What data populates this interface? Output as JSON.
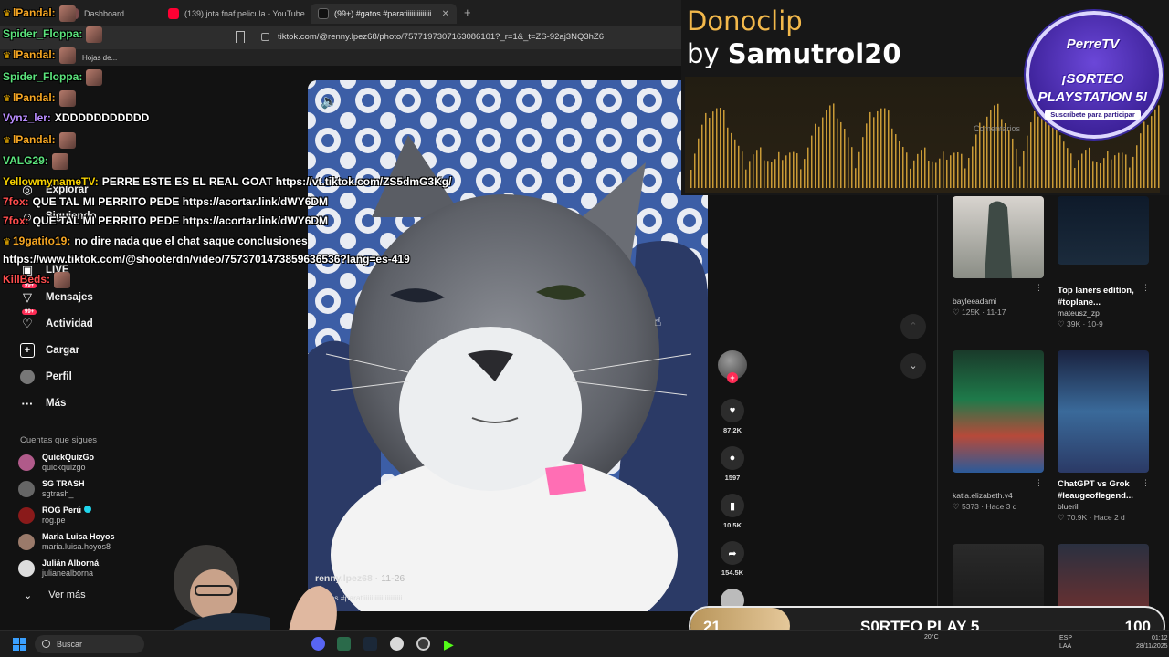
{
  "browser": {
    "tabs": [
      {
        "label": "Dashboard",
        "favicon_color": "#7a4a4a"
      },
      {
        "label": "(139) jota fnaf pelicula - YouTube",
        "favicon_color": "#ff0033"
      },
      {
        "label": "(99+) #gatos #paratiiiiiiiiiiiiiiiiii",
        "favicon_color": "#111111"
      }
    ],
    "url": "tiktok.com/@renny.lpez68/photo/7577197307163086101?_r=1&_t=ZS-92aj3NQ3hZ6",
    "bookmarks": [
      "Hojas de..."
    ]
  },
  "tiktok": {
    "nav": [
      {
        "label": "Explorar",
        "icon": "compass-icon"
      },
      {
        "label": "Siguiendo",
        "icon": "following-icon"
      },
      {
        "label": "LIVE",
        "icon": "live-icon"
      },
      {
        "label": "Mensajes",
        "icon": "messages-icon",
        "badge": "99+"
      },
      {
        "label": "Actividad",
        "icon": "activity-icon",
        "badge": "99+"
      },
      {
        "label": "Cargar",
        "icon": "upload-icon"
      },
      {
        "label": "Perfil",
        "icon": "profile-icon"
      },
      {
        "label": "Más",
        "icon": "more-icon"
      }
    ],
    "search_placeholder": "Buscar",
    "following_title": "Cuentas que sigues",
    "following": [
      {
        "name": "QuickQuizGo",
        "handle": "quickquizgo",
        "color": "#b05a8a"
      },
      {
        "name": "SG TRASH",
        "handle": "sgtrash_",
        "color": "#666666"
      },
      {
        "name": "ROG Perú",
        "handle": "rog.pe",
        "color": "#8a1a1a"
      },
      {
        "name": "Maria Luisa Hoyos",
        "handle": "maria.luisa.hoyos8",
        "color": "#9a7a6a"
      },
      {
        "name": "Julián Alborná",
        "handle": "julianealborna",
        "color": "#dddddd"
      }
    ],
    "see_more": "Ver más",
    "video": {
      "author": "renny.lpez68",
      "date": "11-26",
      "caption": "#gatos #paratiiiiiiiiiiiiiiiiiiiiiii"
    },
    "actions": [
      {
        "icon": "heart-icon",
        "count": "87.2K"
      },
      {
        "icon": "comment-icon",
        "count": "1597"
      },
      {
        "icon": "bookmark-icon",
        "count": "10.5K"
      },
      {
        "icon": "share-icon",
        "count": "154.5K"
      }
    ],
    "comments_label": "Comentarios",
    "related": [
      {
        "title": "",
        "author": "bayleeadami",
        "likes": "125K",
        "date": "11-17"
      },
      {
        "title": "Top laners edition, #toplane...",
        "author": "mateusz_zp",
        "likes": "39K",
        "date": "10-9"
      },
      {
        "title": "",
        "author": "katia.elizabeth.v4",
        "likes": "5373",
        "date": "Hace 3 d"
      },
      {
        "title": "ChatGPT vs Grok #leaugeoflegend...",
        "author": "blueril",
        "likes": "70.9K",
        "date": "Hace 2 d"
      }
    ]
  },
  "chat": [
    {
      "user": "lPandal:",
      "text": "",
      "color": "#f5a623",
      "crown": true,
      "emote": true
    },
    {
      "user": "Spider_Floppa:",
      "text": "",
      "color": "#5be37c",
      "crown": false,
      "emote": true
    },
    {
      "user": "lPandal:",
      "text": "",
      "color": "#f5a623",
      "crown": true,
      "emote": true
    },
    {
      "user": "Spider_Floppa:",
      "text": "",
      "color": "#5be37c",
      "crown": false,
      "emote": true
    },
    {
      "user": "lPandal:",
      "text": "",
      "color": "#f5a623",
      "crown": true,
      "emote": true
    },
    {
      "user": "Vynz_ler:",
      "text": "XDDDDDDDDDDD",
      "color": "#b98cff",
      "crown": false,
      "emote": false
    },
    {
      "user": "lPandal:",
      "text": "",
      "color": "#f5a623",
      "crown": true,
      "emote": true
    },
    {
      "user": "VALG29:",
      "text": "",
      "color": "#5be37c",
      "crown": false,
      "emote": true
    },
    {
      "user": "YellowmynameTV:",
      "text": "PERRE ESTE ES EL REAL GOAT https://vt.tiktok.com/ZS5dmG3Kg/",
      "color": "#f5d000",
      "crown": false,
      "emote": false
    },
    {
      "user": "7fox:",
      "text": "QUE TAL MI PERRITO PEDE https://acortar.link/dWY6DM",
      "color": "#ff4d4d",
      "crown": false,
      "emote": false
    },
    {
      "user": "7fox:",
      "text": "QUE TAL MI PERRITO PEDE https://acortar.link/dWY6DM",
      "color": "#ff4d4d",
      "crown": false,
      "emote": false
    },
    {
      "user": "19gatito19:",
      "text": "no dire nada que el chat saque conclusiones",
      "color": "#f5a623",
      "crown": true,
      "emote": false
    },
    {
      "user": "",
      "text": "https://www.tiktok.com/@shooterdn/video/7573701473859636536?lang=es-419",
      "color": "#ffffff",
      "crown": false,
      "emote": false
    },
    {
      "user": "KillBeds:",
      "text": "",
      "color": "#ff4d4d",
      "crown": false,
      "emote": true
    }
  ],
  "donoclip": {
    "title": "Donoclip",
    "by": "by",
    "user": "Samutrol20"
  },
  "giveaway_badge": {
    "brand": "PerreTV",
    "line1": "¡SORTEO",
    "line2": "PLAYSTATION 5!",
    "sub": "Suscríbete para participar"
  },
  "goal": {
    "current": "21",
    "label": "S0RTEO PLAY 5",
    "target": "100",
    "current_value": 21,
    "target_value": 100
  },
  "taskbar": {
    "search": "Buscar",
    "lang": "ESP",
    "lang2": "LAA",
    "time": "01:12",
    "date": "28/11/2025",
    "weather": "20°C"
  }
}
